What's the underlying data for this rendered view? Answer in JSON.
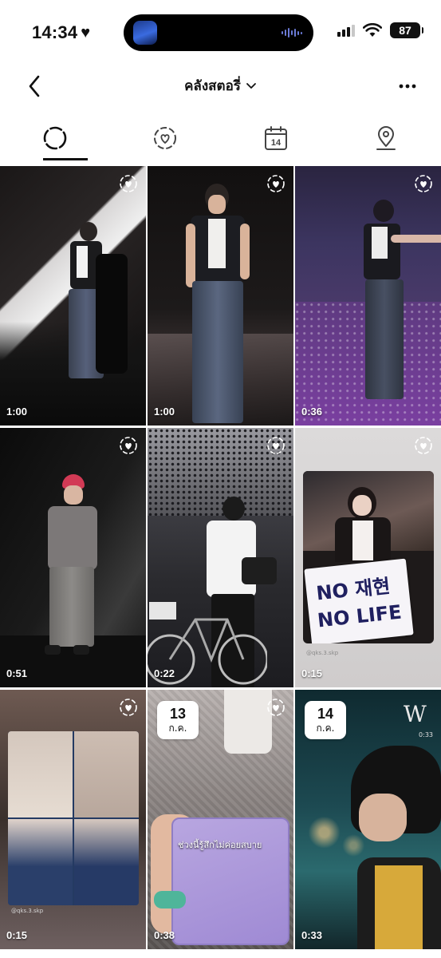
{
  "status_bar": {
    "time": "14:34",
    "heart": "♥",
    "battery": "87"
  },
  "header": {
    "title": "คลังสตอรี่",
    "back_icon": "chevron-left-icon",
    "more_icon": "more-horizontal-icon"
  },
  "tabs": [
    {
      "name": "stories",
      "icon": "story-ring-icon",
      "active": true
    },
    {
      "name": "favorites",
      "icon": "heart-circle-icon",
      "active": false
    },
    {
      "name": "calendar",
      "icon": "calendar-icon",
      "day": "14",
      "active": false
    },
    {
      "name": "places",
      "icon": "location-pin-icon",
      "active": false
    }
  ],
  "grid": [
    {
      "duration": "1:00",
      "favorite": true
    },
    {
      "duration": "1:00",
      "favorite": true
    },
    {
      "duration": "0:36",
      "favorite": true
    },
    {
      "duration": "0:51",
      "favorite": true
    },
    {
      "duration": "0:22",
      "favorite": true
    },
    {
      "duration": "0:15",
      "favorite": true,
      "sign_line1": "NO 재현",
      "sign_line2": "NO LIFE",
      "watermark": "@qks.3.skp"
    },
    {
      "duration": "0:15",
      "favorite": true,
      "watermark": "@qks.3.skp"
    },
    {
      "duration": "0:38",
      "favorite": true,
      "date_day": "13",
      "date_month": "ก.ค.",
      "caption": "ช่วงนี้รู้สึกไม่ค่อยสบาย"
    },
    {
      "duration": "0:33",
      "favorite": false,
      "date_day": "14",
      "date_month": "ก.ค.",
      "corner_time": "0:33",
      "logo": "W"
    }
  ]
}
